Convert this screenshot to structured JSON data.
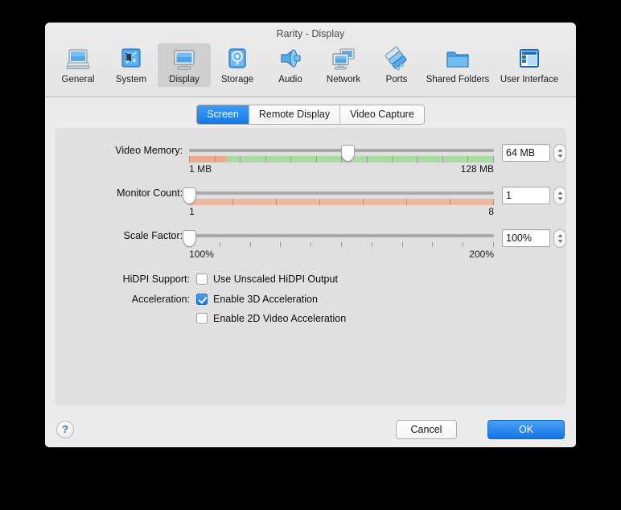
{
  "window": {
    "title": "Rarity - Display"
  },
  "toolbar": {
    "items": [
      {
        "label": "General",
        "icon": "monitor-laptop-icon"
      },
      {
        "label": "System",
        "icon": "chip-icon"
      },
      {
        "label": "Display",
        "icon": "display-monitor-icon",
        "selected": true
      },
      {
        "label": "Storage",
        "icon": "hard-disk-icon"
      },
      {
        "label": "Audio",
        "icon": "speaker-icon"
      },
      {
        "label": "Network",
        "icon": "network-monitors-icon"
      },
      {
        "label": "Ports",
        "icon": "ports-plugs-icon"
      },
      {
        "label": "Shared Folders",
        "icon": "folder-icon"
      },
      {
        "label": "User Interface",
        "icon": "window-layout-icon"
      }
    ]
  },
  "tabs": [
    {
      "label": "Screen",
      "active": true
    },
    {
      "label": "Remote Display",
      "active": false
    },
    {
      "label": "Video Capture",
      "active": false
    }
  ],
  "form": {
    "video_memory": {
      "label": "Video Memory:",
      "min_label": "1 MB",
      "max_label": "128 MB",
      "value": "64 MB",
      "handle_percent": 52,
      "warn_percent": 12,
      "colors": {
        "warn": "#eeab8e",
        "ok": "#a9dba2"
      }
    },
    "monitor_count": {
      "label": "Monitor Count:",
      "min_label": "1",
      "max_label": "8",
      "value": "1",
      "handle_percent": 0,
      "colors": {
        "warn": "#eeb79f"
      }
    },
    "scale_factor": {
      "label": "Scale Factor:",
      "min_label": "100%",
      "max_label": "200%",
      "value": "100%",
      "handle_percent": 0
    },
    "hidpi": {
      "label": "HiDPI Support:",
      "checkbox_label": "Use Unscaled HiDPI Output",
      "checked": false
    },
    "acceleration": {
      "label": "Acceleration:",
      "items": [
        {
          "checkbox_label": "Enable 3D Acceleration",
          "checked": true
        },
        {
          "checkbox_label": "Enable 2D Video Acceleration",
          "checked": false
        }
      ]
    }
  },
  "footer": {
    "help_label": "?",
    "cancel_label": "Cancel",
    "ok_label": "OK"
  },
  "colors": {
    "accent": "#1374e6",
    "window_bg": "#ececec",
    "panel_bg": "#e0e0e0"
  }
}
